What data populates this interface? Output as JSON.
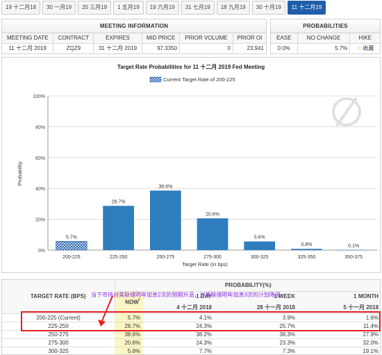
{
  "tabs": [
    "19 十二月18",
    "30 一月19",
    "20 三月19",
    "1 五月19",
    "19 六月19",
    "31 七月19",
    "18 九月19",
    "30 十月19",
    "11 十二月19"
  ],
  "active_tab": 8,
  "meeting_info": {
    "title": "MEETING INFORMATION",
    "headers": [
      "MEETING DATE",
      "CONTRACT",
      "EXPIRES",
      "MID PRICE",
      "PRIOR VOLUME",
      "PRIOR OI"
    ],
    "values": [
      "11 十二月 2019",
      "ZQZ9",
      "31 十二月 2019",
      "97.3350",
      "0",
      "23,941"
    ]
  },
  "probabilities": {
    "title": "PROBABILITIES",
    "headers": [
      "EASE",
      "NO CHANGE",
      "HIKE"
    ],
    "values": [
      "0.0%",
      "5.7%",
      ""
    ],
    "follow_label": "收藏"
  },
  "chart_data": {
    "type": "bar",
    "title": "Target Rate Probabilities for 11 十二月 2019  Fed Meeting",
    "legend": "Current Target Rate of 200-225",
    "legend_position": "top-center",
    "xlabel": "Target Rate (in bps)",
    "ylabel": "Probability",
    "categories": [
      "200-225",
      "225-250",
      "250-275",
      "275-300",
      "300-325",
      "325-350",
      "350-375"
    ],
    "values": [
      5.7,
      28.7,
      38.6,
      20.6,
      5.6,
      0.8,
      0.1
    ],
    "value_labels": [
      "5.7%",
      "28.7%",
      "38.6%",
      "20.6%",
      "5.6%",
      "0.8%",
      "0.1%"
    ],
    "current_index": 0,
    "ylim": [
      0,
      100
    ],
    "yticks": [
      0,
      20,
      40,
      60,
      80,
      100
    ],
    "ytick_labels": [
      "0%",
      "20%",
      "40%",
      "60%",
      "80%",
      "100%"
    ],
    "grid": true,
    "bar_color": "#2e7dbf",
    "current_color": "#1f5ea8"
  },
  "prob_table": {
    "col_rate": "TARGET RATE (BPS)",
    "col_prob": "PROBABILITY(%)",
    "annotation": "当下市场对美联储明年加息2次的预期升温，对美联储明年加息3次的计划降温",
    "sub_headers": [
      {
        "line1": "NOW",
        "line2": ""
      },
      {
        "line1": "1 DAY",
        "line2": "4 十二月 2018"
      },
      {
        "line1": "1 WEEK",
        "line2": "28 十一月 2018"
      },
      {
        "line1": "1 MONTH",
        "line2": "5 十一月 2018"
      }
    ],
    "now_marker": "*",
    "rows": [
      {
        "rate": "200-225 (Current)",
        "now": "5.7%",
        "day": "4.1%",
        "week": "3.9%",
        "month": "1.6%"
      },
      {
        "rate": "225-250",
        "now": "28.7%",
        "day": "24.3%",
        "week": "25.7%",
        "month": "11.4%"
      },
      {
        "rate": "250-275",
        "now": "38.6%",
        "day": "38.2%",
        "week": "38.3%",
        "month": "27.9%"
      },
      {
        "rate": "275-300",
        "now": "20.6%",
        "day": "24.3%",
        "week": "23.3%",
        "month": "32.0%"
      },
      {
        "rate": "300-325",
        "now": "5.6%",
        "day": "7.7%",
        "week": "7.3%",
        "month": "19.1%"
      }
    ],
    "highlight_color": "#e02020"
  }
}
